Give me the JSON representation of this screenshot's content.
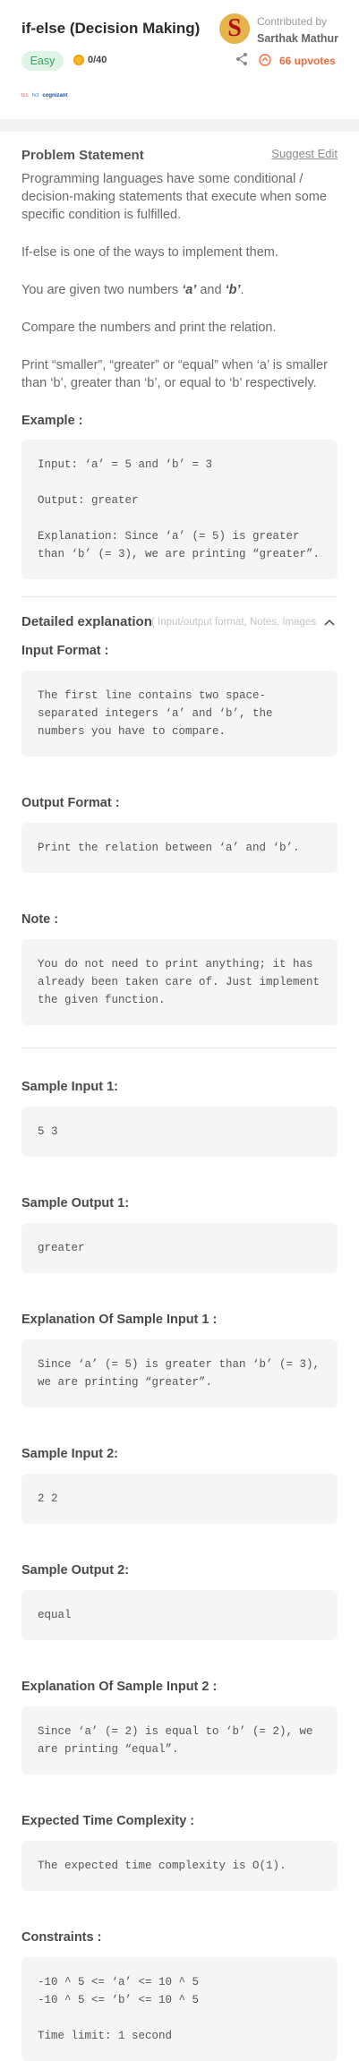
{
  "header": {
    "title": "if-else (Decision Making)",
    "difficulty": "Easy",
    "score": "0/40",
    "contributed_label": "Contributed by",
    "contributor": "Sarthak Mathur",
    "upvotes": "66 upvotes",
    "avatar_letter": "S",
    "companies": [
      "tcs",
      "hcl",
      "cognizant"
    ]
  },
  "problem": {
    "heading": "Problem Statement",
    "suggest_edit": "Suggest Edit",
    "p1": "Programming languages have some conditional / decision-making statements that execute when some specific condition is fulfilled.",
    "p2": "If-else is one of the ways to implement them.",
    "p3_prefix": "You are given two numbers ",
    "p3_a": "‘a’",
    "p3_and": " and ",
    "p3_b": "‘b’",
    "p3_suffix": ".",
    "p4": "Compare the numbers and print the relation.",
    "p5": "Print “smaller”, “greater” or “equal” when ‘a’ is smaller than ‘b’, greater than ‘b’, or equal to ‘b’ respectively."
  },
  "example": {
    "label": "Example :",
    "code": "Input: ‘a’ = 5 and ‘b’ = 3\n\nOutput: greater\n\nExplanation: Since ‘a’ (= 5) is greater than ‘b’ (= 3), we are printing “greater”."
  },
  "detailed": {
    "title": "Detailed explanation",
    "hint": "( Input/output format, Notes, Images )"
  },
  "sections": [
    {
      "label": "Input Format :",
      "code": "The first line contains two space-separated integers ‘a’ and ‘b’, the numbers you have to compare."
    },
    {
      "label": "Output Format :",
      "code": "Print the relation between ‘a’ and ‘b’."
    },
    {
      "label": "Note :",
      "code": "You do not need to print anything; it has already been taken care of. Just implement the given function."
    },
    {
      "label": "Sample Input 1:",
      "code": "5 3"
    },
    {
      "label": "Sample Output 1:",
      "code": "greater"
    },
    {
      "label": "Explanation Of Sample Input 1 :",
      "code": "Since ‘a’ (= 5) is greater than ‘b’ (= 3), we are printing “greater”."
    },
    {
      "label": "Sample Input 2:",
      "code": "2 2"
    },
    {
      "label": "Sample Output 2:",
      "code": "equal"
    },
    {
      "label": "Explanation Of Sample Input 2 :",
      "code": "Since ‘a’ (= 2) is equal to ‘b’ (= 2), we are printing “equal”."
    },
    {
      "label": "Expected Time Complexity :",
      "code": "The expected time complexity is O(1)."
    },
    {
      "label": "Constraints :",
      "code": "-10 ^ 5 <= ‘a’ <= 10 ^ 5\n-10 ^ 5 <= ‘b’ <= 10 ^ 5\n\nTime limit: 1 second"
    }
  ],
  "colors": {
    "accent": "#f26b38",
    "easy_bg": "#dff3e6",
    "easy_text": "#36a35b",
    "code_bg": "#f5f5f5"
  }
}
